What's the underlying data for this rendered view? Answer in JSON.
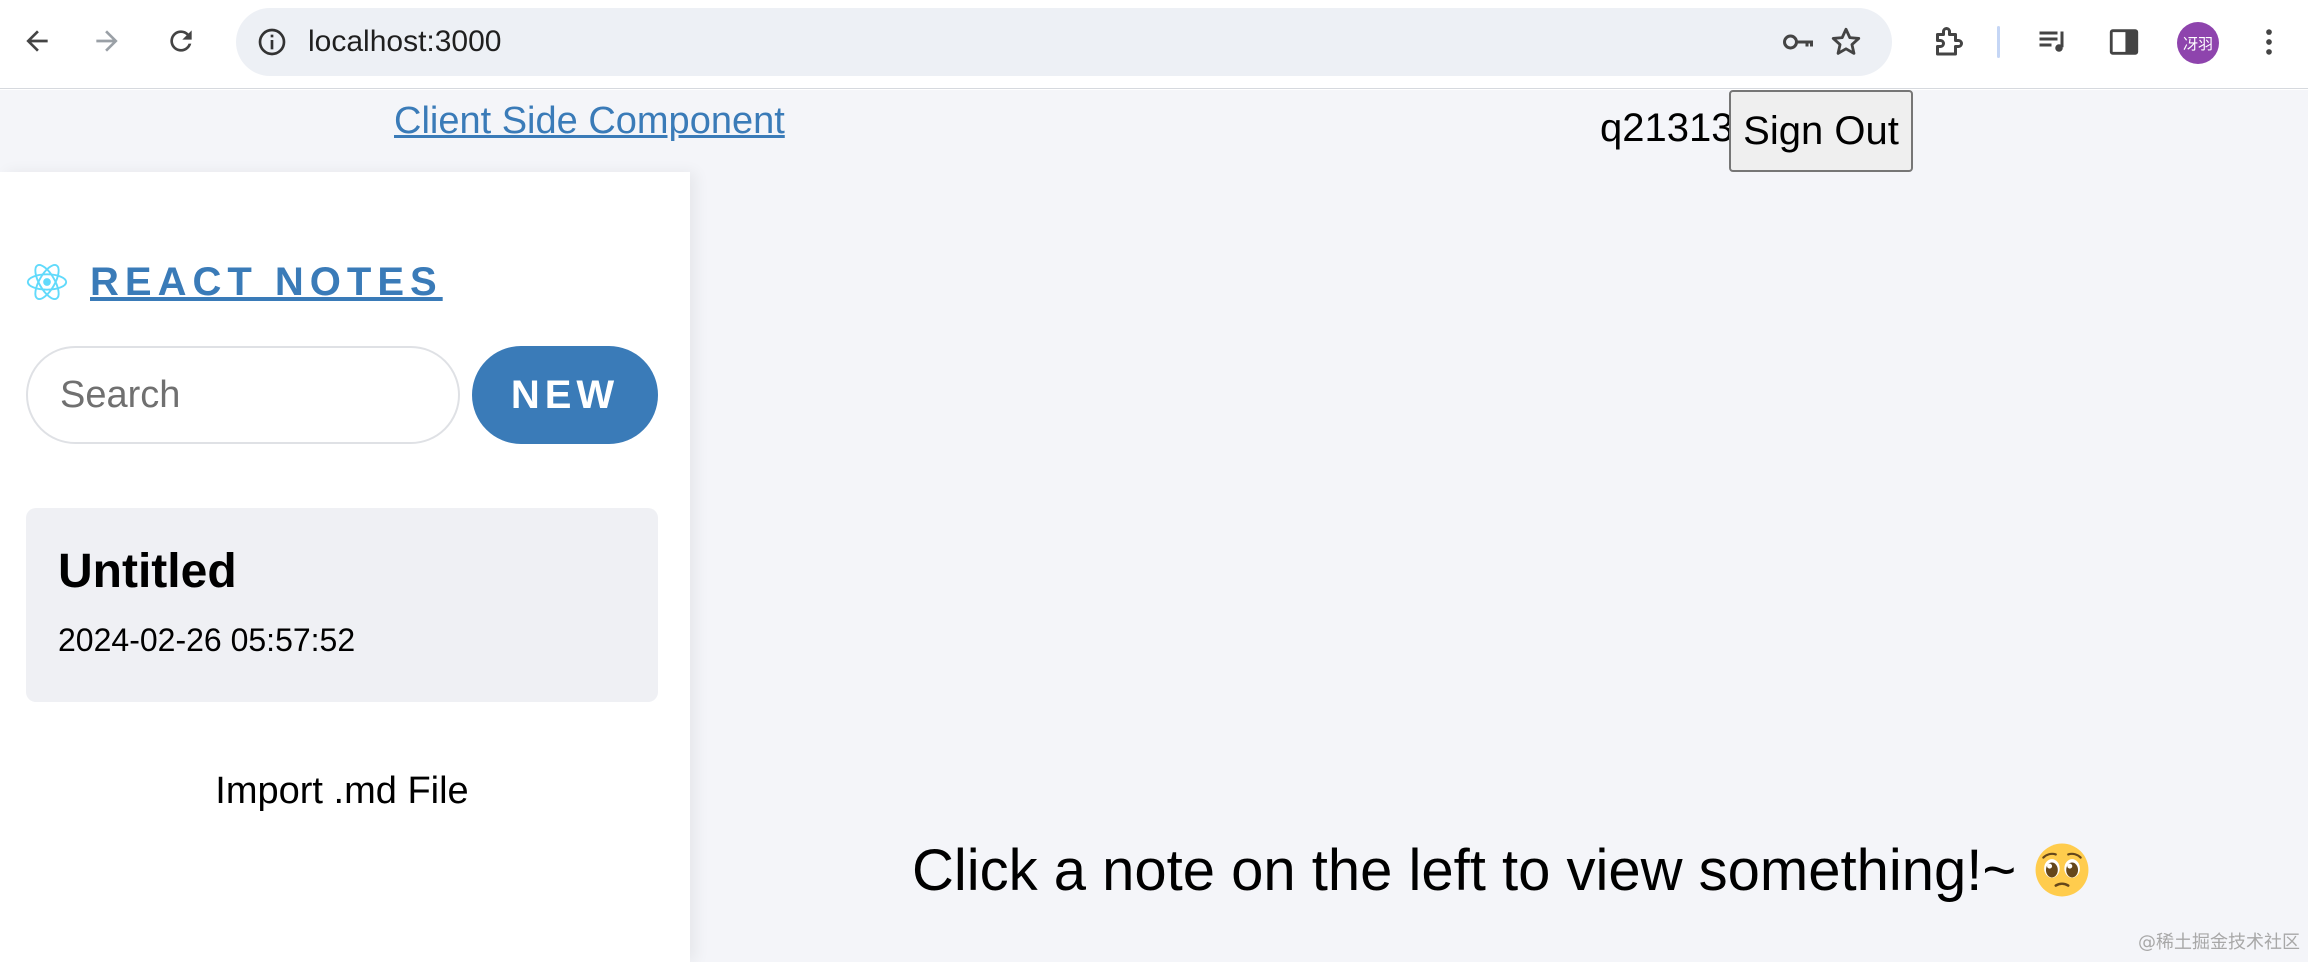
{
  "browser": {
    "url": "localhost:3000",
    "avatar_text": "冴羽",
    "icons": {
      "back": "back-arrow-icon",
      "forward": "forward-arrow-icon",
      "reload": "reload-icon",
      "site_info": "info-icon",
      "password": "key-icon",
      "bookmark": "star-icon",
      "extensions": "puzzle-icon",
      "media": "media-queue-icon",
      "side_panel": "side-panel-icon",
      "menu": "kebab-menu-icon"
    }
  },
  "header": {
    "client_link": "Client Side Component",
    "username": "q21313",
    "sign_out": "Sign Out"
  },
  "sidebar": {
    "brand": "REACT NOTES",
    "brand_icon": "react-logo-icon",
    "search_placeholder": "Search",
    "new_button": "NEW",
    "notes": [
      {
        "title": "Untitled",
        "date": "2024-02-26 05:57:52"
      }
    ],
    "import_label": "Import .md File"
  },
  "main": {
    "empty_message": "Click a note on the left to view something!~",
    "emoji": "pleading-face"
  },
  "watermark": "@稀土掘金技术社区",
  "colors": {
    "accent": "#3a7bb8",
    "page_bg": "#f4f5f9",
    "note_bg": "#eff0f4"
  }
}
